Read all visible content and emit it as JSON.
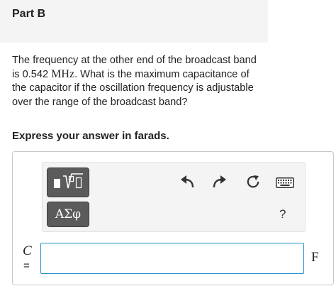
{
  "part": {
    "title": "Part B"
  },
  "question": {
    "text_before": "The frequency at the other end of the broadcast band is 0.542 ",
    "unit": "MHz",
    "text_after": ". What is the maximum capacitance of the capacitor if the oscillation frequency is adjustable over the range of the broadcast band?"
  },
  "instruction": "Express your answer in farads.",
  "toolbar": {
    "templates_icon": "math-templates-icon",
    "symbols_label": "ΑΣφ",
    "undo_icon": "undo-icon",
    "redo_icon": "redo-icon",
    "reset_icon": "reset-icon",
    "keyboard_icon": "keyboard-icon",
    "help_label": "?"
  },
  "answer": {
    "variable": "C",
    "equals": "=",
    "value": "",
    "unit": "F"
  },
  "colors": {
    "header_bg": "#f4f4f4",
    "toolbar_bg": "#f4f4f4",
    "button_bg": "#5b5b5b",
    "input_border": "#1c8fd0"
  }
}
